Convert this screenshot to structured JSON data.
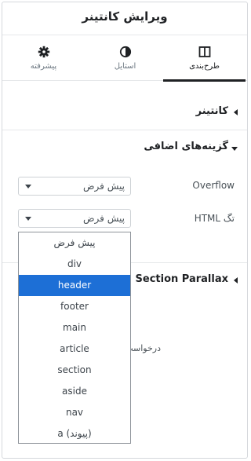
{
  "header": {
    "title": "ویرایش کانتینر"
  },
  "tabs": [
    {
      "label": "طرح‌بندی",
      "icon": "layout-columns-icon",
      "active": true
    },
    {
      "label": "استایل",
      "icon": "half-circle-icon",
      "active": false
    },
    {
      "label": "پیشرفته",
      "icon": "gear-icon",
      "active": false
    }
  ],
  "sections": {
    "container": {
      "title": "کانتینر",
      "state": "collapsed"
    },
    "additional_options": {
      "title": "گزینه‌های اضافی",
      "state": "expanded"
    },
    "section_parallax": {
      "title": "Section Parallax",
      "state": "collapsed"
    }
  },
  "controls": {
    "overflow": {
      "label": "Overflow",
      "value": "پیش فرض"
    },
    "html_tag": {
      "label": "تگ HTML",
      "value": "پیش فرض"
    }
  },
  "dropdown": {
    "options": [
      "پیش فرض",
      "div",
      "header",
      "footer",
      "main",
      "article",
      "section",
      "aside",
      "nav",
      "a (پیوند)"
    ],
    "highlighted": "header"
  },
  "partial_label": "درخواست"
}
